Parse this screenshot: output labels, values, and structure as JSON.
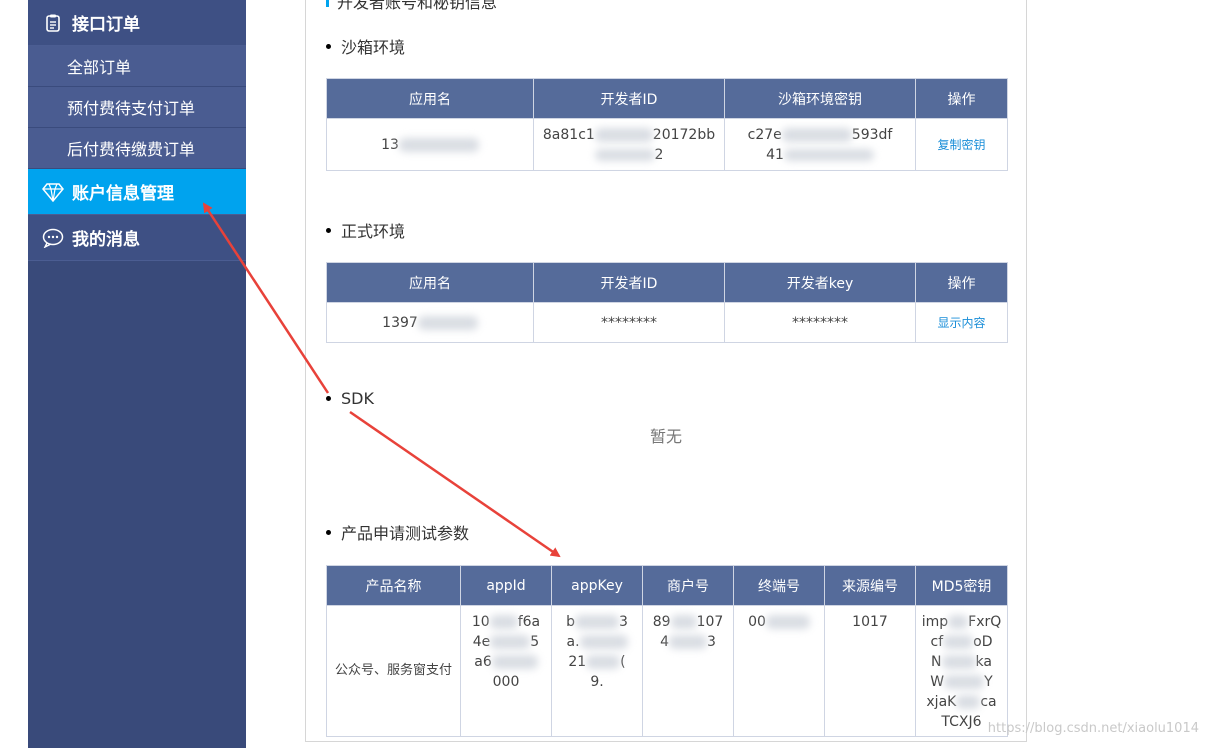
{
  "sidebar": {
    "group_orders": {
      "label": "接口订单",
      "icon": "clipboard-icon"
    },
    "submenu": [
      {
        "label": "全部订单"
      },
      {
        "label": "预付费待支付订单"
      },
      {
        "label": "后付费待缴费订单"
      }
    ],
    "group_account": {
      "label": "账户信息管理",
      "icon": "diamond-icon"
    },
    "group_messages": {
      "label": "我的消息",
      "icon": "chat-bubble-icon"
    }
  },
  "content": {
    "section_title": "开发者账号和秘钥信息",
    "sandbox": {
      "heading": "沙箱环境",
      "columns": [
        "应用名",
        "开发者ID",
        "沙箱环境密钥",
        "操作"
      ],
      "row": {
        "app_name": "13",
        "dev_id_line1": "8a81c1",
        "dev_id_line1_tail": "20172bb",
        "dev_id_line2_tail": "2",
        "secret_line1_head": "c27e",
        "secret_line1_tail": "593df",
        "secret_line2_head": "41",
        "action": "复制密钥"
      }
    },
    "production": {
      "heading": "正式环境",
      "columns": [
        "应用名",
        "开发者ID",
        "开发者key",
        "操作"
      ],
      "row": {
        "app_name": "1397",
        "dev_id": "********",
        "dev_key": "********",
        "action": "显示内容"
      }
    },
    "sdk": {
      "heading": "SDK",
      "empty_text": "暂无"
    },
    "product_params": {
      "heading": "产品申请测试参数",
      "columns": [
        "产品名称",
        "appId",
        "appKey",
        "商户号",
        "终端号",
        "来源编号",
        "MD5密钥"
      ],
      "row": {
        "product_name": "公众号、服务窗支付",
        "app_id_l1_head": "10",
        "app_id_l1_tail": "f6a",
        "app_id_l2_head": "4e",
        "app_id_l2_tail": "5",
        "app_id_l3_head": "a6",
        "app_id_l4": "000",
        "app_key_l1_head": "b",
        "app_key_l1_tail": "3",
        "app_key_l2_head": "a.",
        "app_key_l3_head": "21",
        "app_key_l3_tail": "(",
        "app_key_l4": "9.",
        "merchant_l1_head": "89",
        "merchant_l1_tail": "107",
        "merchant_l2_head": "4",
        "merchant_l2_tail": "3",
        "terminal": "00",
        "source_no": "1017",
        "md5_l1_head": "imp",
        "md5_l1_tail": "FxrQ",
        "md5_l2_head": "cf",
        "md5_l2_tail": "oD",
        "md5_l3_head": "N",
        "md5_l3_tail": "ka",
        "md5_l4_head": "W",
        "md5_l4_tail": "Y",
        "md5_l5_head": "xjaK",
        "md5_l5_tail": "ca",
        "md5_l6": "TCXJ6"
      }
    }
  },
  "watermark": "https://blog.csdn.net/xiaolu1014",
  "colors": {
    "sidebar_bg": "#394a7a",
    "active_item": "#00a3ee",
    "table_header": "#556b9a",
    "link": "#1a8ed8",
    "arrow": "#e8423a"
  }
}
